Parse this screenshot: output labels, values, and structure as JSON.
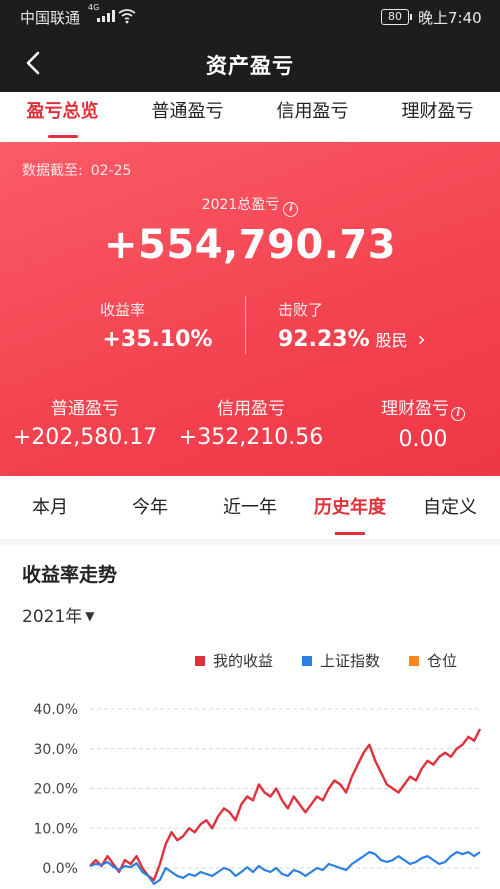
{
  "status_bar": {
    "carrier": "中国联通",
    "network": "4G",
    "battery": "80",
    "time": "晚上7:40"
  },
  "nav": {
    "title": "资产盈亏"
  },
  "top_tabs": [
    {
      "label": "盈亏总览",
      "active": true
    },
    {
      "label": "普通盈亏",
      "active": false
    },
    {
      "label": "信用盈亏",
      "active": false
    },
    {
      "label": "理财盈亏",
      "active": false
    }
  ],
  "summary": {
    "date_label": "数据截至:",
    "date_value": "02-25",
    "year_title": "2021总盈亏",
    "total": "+554,790.73",
    "rate_label": "收益率",
    "rate_value": "+35.10%",
    "beat_label": "击败了",
    "beat_value": "92.23%",
    "beat_suffix": "股民",
    "breakdown": [
      {
        "label": "普通盈亏",
        "value": "+202,580.17"
      },
      {
        "label": "信用盈亏",
        "value": "+352,210.56"
      },
      {
        "label": "理财盈亏",
        "value": "0.00"
      }
    ]
  },
  "period_tabs": [
    {
      "label": "本月",
      "active": false
    },
    {
      "label": "今年",
      "active": false
    },
    {
      "label": "近一年",
      "active": false
    },
    {
      "label": "历史年度",
      "active": true
    },
    {
      "label": "自定义",
      "active": false
    }
  ],
  "chart_section": {
    "title": "收益率走势",
    "year": "2021年"
  },
  "colors": {
    "red": "#e0303a",
    "blue": "#2a7fe3",
    "orange": "#f5871f",
    "header": "#1d1d20"
  },
  "chart_data": {
    "type": "line",
    "ylim": [
      -5,
      45
    ],
    "yticks": [
      "40.0%",
      "30.0%",
      "20.0%",
      "10.0%",
      "0.0%"
    ],
    "ytick_values": [
      40,
      30,
      20,
      10,
      0
    ],
    "legend": [
      {
        "name": "我的收益",
        "color": "#e0303a"
      },
      {
        "name": "上证指数",
        "color": "#2a7fe3"
      },
      {
        "name": "仓位",
        "color": "#f5871f"
      }
    ],
    "series": [
      {
        "name": "我的收益",
        "color": "#e0303a",
        "values": [
          0.5,
          2,
          0.5,
          3,
          1,
          -1,
          2,
          1,
          3,
          0,
          -2,
          -3,
          1,
          6,
          9,
          7,
          8,
          10,
          9,
          11,
          12,
          10,
          13,
          15,
          14,
          12,
          16,
          18,
          17,
          21,
          19,
          18,
          20,
          17,
          15,
          18,
          16,
          14,
          16,
          18,
          17,
          20,
          22,
          21,
          19,
          23,
          26,
          29,
          31,
          27,
          24,
          21,
          20,
          19,
          21,
          23,
          22,
          25,
          27,
          26,
          28,
          29,
          28,
          30,
          31,
          33,
          32,
          35
        ]
      },
      {
        "name": "上证指数",
        "color": "#2a7fe3",
        "values": [
          0.5,
          1,
          0.8,
          1.5,
          0.3,
          -0.5,
          0.5,
          0.2,
          1.2,
          -1,
          -2,
          -4,
          -3,
          0,
          -1,
          -2,
          -2.5,
          -1.5,
          -2,
          -1,
          -1.5,
          -2,
          -1,
          0,
          -0.5,
          -2,
          -1,
          0.2,
          -1,
          0.5,
          -0.5,
          -1,
          0,
          -1.5,
          -2,
          -0.5,
          -1,
          -2,
          -1,
          0,
          -0.5,
          1,
          0.5,
          0,
          -0.5,
          1,
          2,
          3,
          4,
          3.5,
          2,
          1.5,
          2,
          3,
          2,
          1,
          1.5,
          2.5,
          3,
          2,
          1,
          1.5,
          3,
          4,
          3.5,
          4,
          3,
          4
        ]
      }
    ]
  }
}
